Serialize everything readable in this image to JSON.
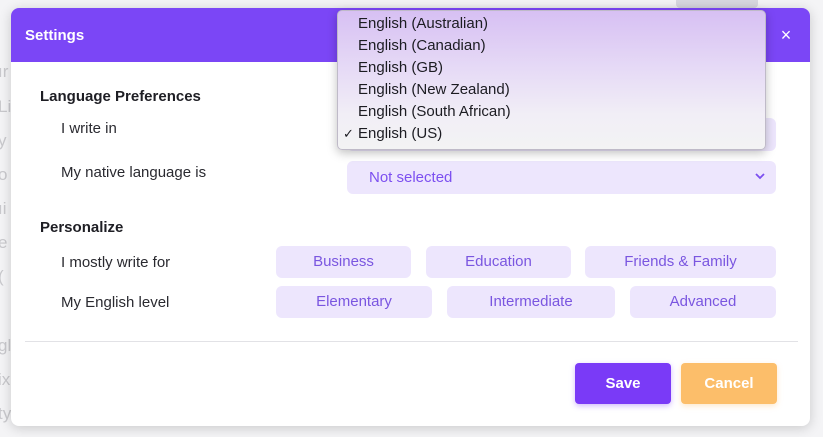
{
  "background": {
    "fragments": [
      "ır",
      "Li",
      "y",
      "o",
      "ıi",
      "e",
      "(",
      "gl",
      "ix",
      "ty"
    ]
  },
  "modal": {
    "title": "Settings",
    "close_label": "×",
    "header_color": "#7b46f6",
    "language_section": {
      "title": "Language Preferences",
      "write_in_label": "I write in",
      "native_label": "My native language is",
      "native_value": "Not selected"
    },
    "dropdown": {
      "options": [
        {
          "label": "English (Australian)",
          "selected": false
        },
        {
          "label": "English (Canadian)",
          "selected": false
        },
        {
          "label": "English (GB)",
          "selected": false
        },
        {
          "label": "English (New Zealand)",
          "selected": false
        },
        {
          "label": "English (South African)",
          "selected": false
        },
        {
          "label": "English (US)",
          "selected": true
        }
      ],
      "check_mark": "✓"
    },
    "personalize_section": {
      "title": "Personalize",
      "write_for_label": "I mostly write for",
      "write_for_options": [
        "Business",
        "Education",
        "Friends & Family"
      ],
      "level_label": "My English level",
      "level_options": [
        "Elementary",
        "Intermediate",
        "Advanced"
      ]
    },
    "buttons": {
      "save": "Save",
      "cancel": "Cancel"
    },
    "colors": {
      "accent": "#7a3af7",
      "cancel": "#fcbe6a",
      "chip_bg": "#ede6fd"
    }
  }
}
